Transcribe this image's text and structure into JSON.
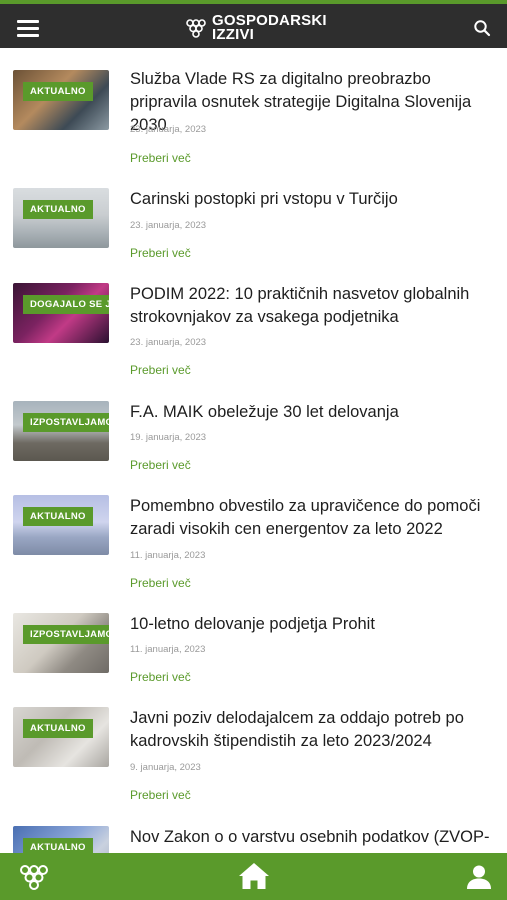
{
  "header": {
    "logo_line1": "GOSPODARSKI",
    "logo_line2": "IZZIVI",
    "menu_icon": "hamburger-icon",
    "search_icon": "search-icon"
  },
  "colors": {
    "accent": "#5a9a2b",
    "header_bg": "#2e2e2e",
    "title": "#1e1e1e",
    "date": "#9a9a9a"
  },
  "articles": [
    {
      "badge": "AKTUALNO",
      "title": "Služba Vlade RS za digitalno preobrazbo pripravila osnutek strategije Digitalna Slovenija 2030",
      "date": "23. januarja, 2023",
      "more": "Preberi več"
    },
    {
      "badge": "AKTUALNO",
      "title": "Carinski postopki pri vstopu v Turčijo",
      "date": "23. januarja, 2023",
      "more": "Preberi več"
    },
    {
      "badge": "DOGAJALO SE JE",
      "title": "PODIM 2022: 10 praktičnih nasvetov globalnih strokovnjakov za vsakega podjetnika",
      "date": "23. januarja, 2023",
      "more": "Preberi več"
    },
    {
      "badge": "IZPOSTAVLJAMO",
      "title": "F.A. MAIK obeležuje 30 let delovanja",
      "date": "19. januarja, 2023",
      "more": "Preberi več"
    },
    {
      "badge": "AKTUALNO",
      "title": "Pomembno obvestilo za upravičence do pomoči zaradi visokih cen energentov za leto 2022",
      "date": "11. januarja, 2023",
      "more": "Preberi več"
    },
    {
      "badge": "IZPOSTAVLJAMO",
      "title": "10-letno delovanje podjetja Prohit",
      "date": "11. januarja, 2023",
      "more": "Preberi več"
    },
    {
      "badge": "AKTUALNO",
      "title": "Javni poziv delodajalcem za oddajo potreb po kadrovskih štipendistih za leto 2023/2024",
      "date": "9. januarja, 2023",
      "more": "Preberi več"
    },
    {
      "badge": "AKTUALNO",
      "title": "Nov Zakon o o varstvu osebnih podatkov (ZVOP-",
      "date": "",
      "more": ""
    }
  ],
  "bottom_nav": {
    "logo_icon": "grapes-logo-icon",
    "home_icon": "home-icon",
    "user_icon": "user-icon"
  }
}
